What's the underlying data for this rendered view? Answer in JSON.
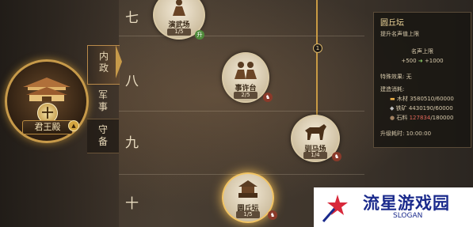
{
  "hall": {
    "name": "君王殿",
    "rank": "十"
  },
  "tabs": [
    {
      "label": "内\n政"
    },
    {
      "label": "军\n事"
    },
    {
      "label": "守\n备"
    }
  ],
  "tiers": [
    "七",
    "八",
    "九",
    "十"
  ],
  "marker": "1",
  "nodes": {
    "yanwu": {
      "name": "演武场",
      "level": "1/5",
      "tag": "升"
    },
    "shixu": {
      "name": "事许台",
      "level": "2/5"
    },
    "xunma": {
      "name": "驯马场",
      "level": "1/4"
    },
    "yuanqiu": {
      "name": "圆丘坛",
      "level": "1/5"
    }
  },
  "panel": {
    "title": "圆丘坛",
    "desc": "提升名声值上限",
    "sub_title": "名声上限",
    "sub_from": "+500",
    "sub_to": "+1000",
    "special": "特殊效果: 无",
    "cost_title": "建造消耗:",
    "wood": "木材 3580510/60000",
    "iron": "铁矿 4430190/60000",
    "stone_label": "石料",
    "stone_have": "127834",
    "stone_need": "/180000",
    "time": "升级耗时: 10:00:00"
  },
  "watermark": {
    "text": "流星游戏园",
    "slogan": "SLOGAN"
  },
  "colors": {
    "accent": "#c79a4a",
    "ok": "#8fcf6a",
    "lack": "#e0675a"
  }
}
